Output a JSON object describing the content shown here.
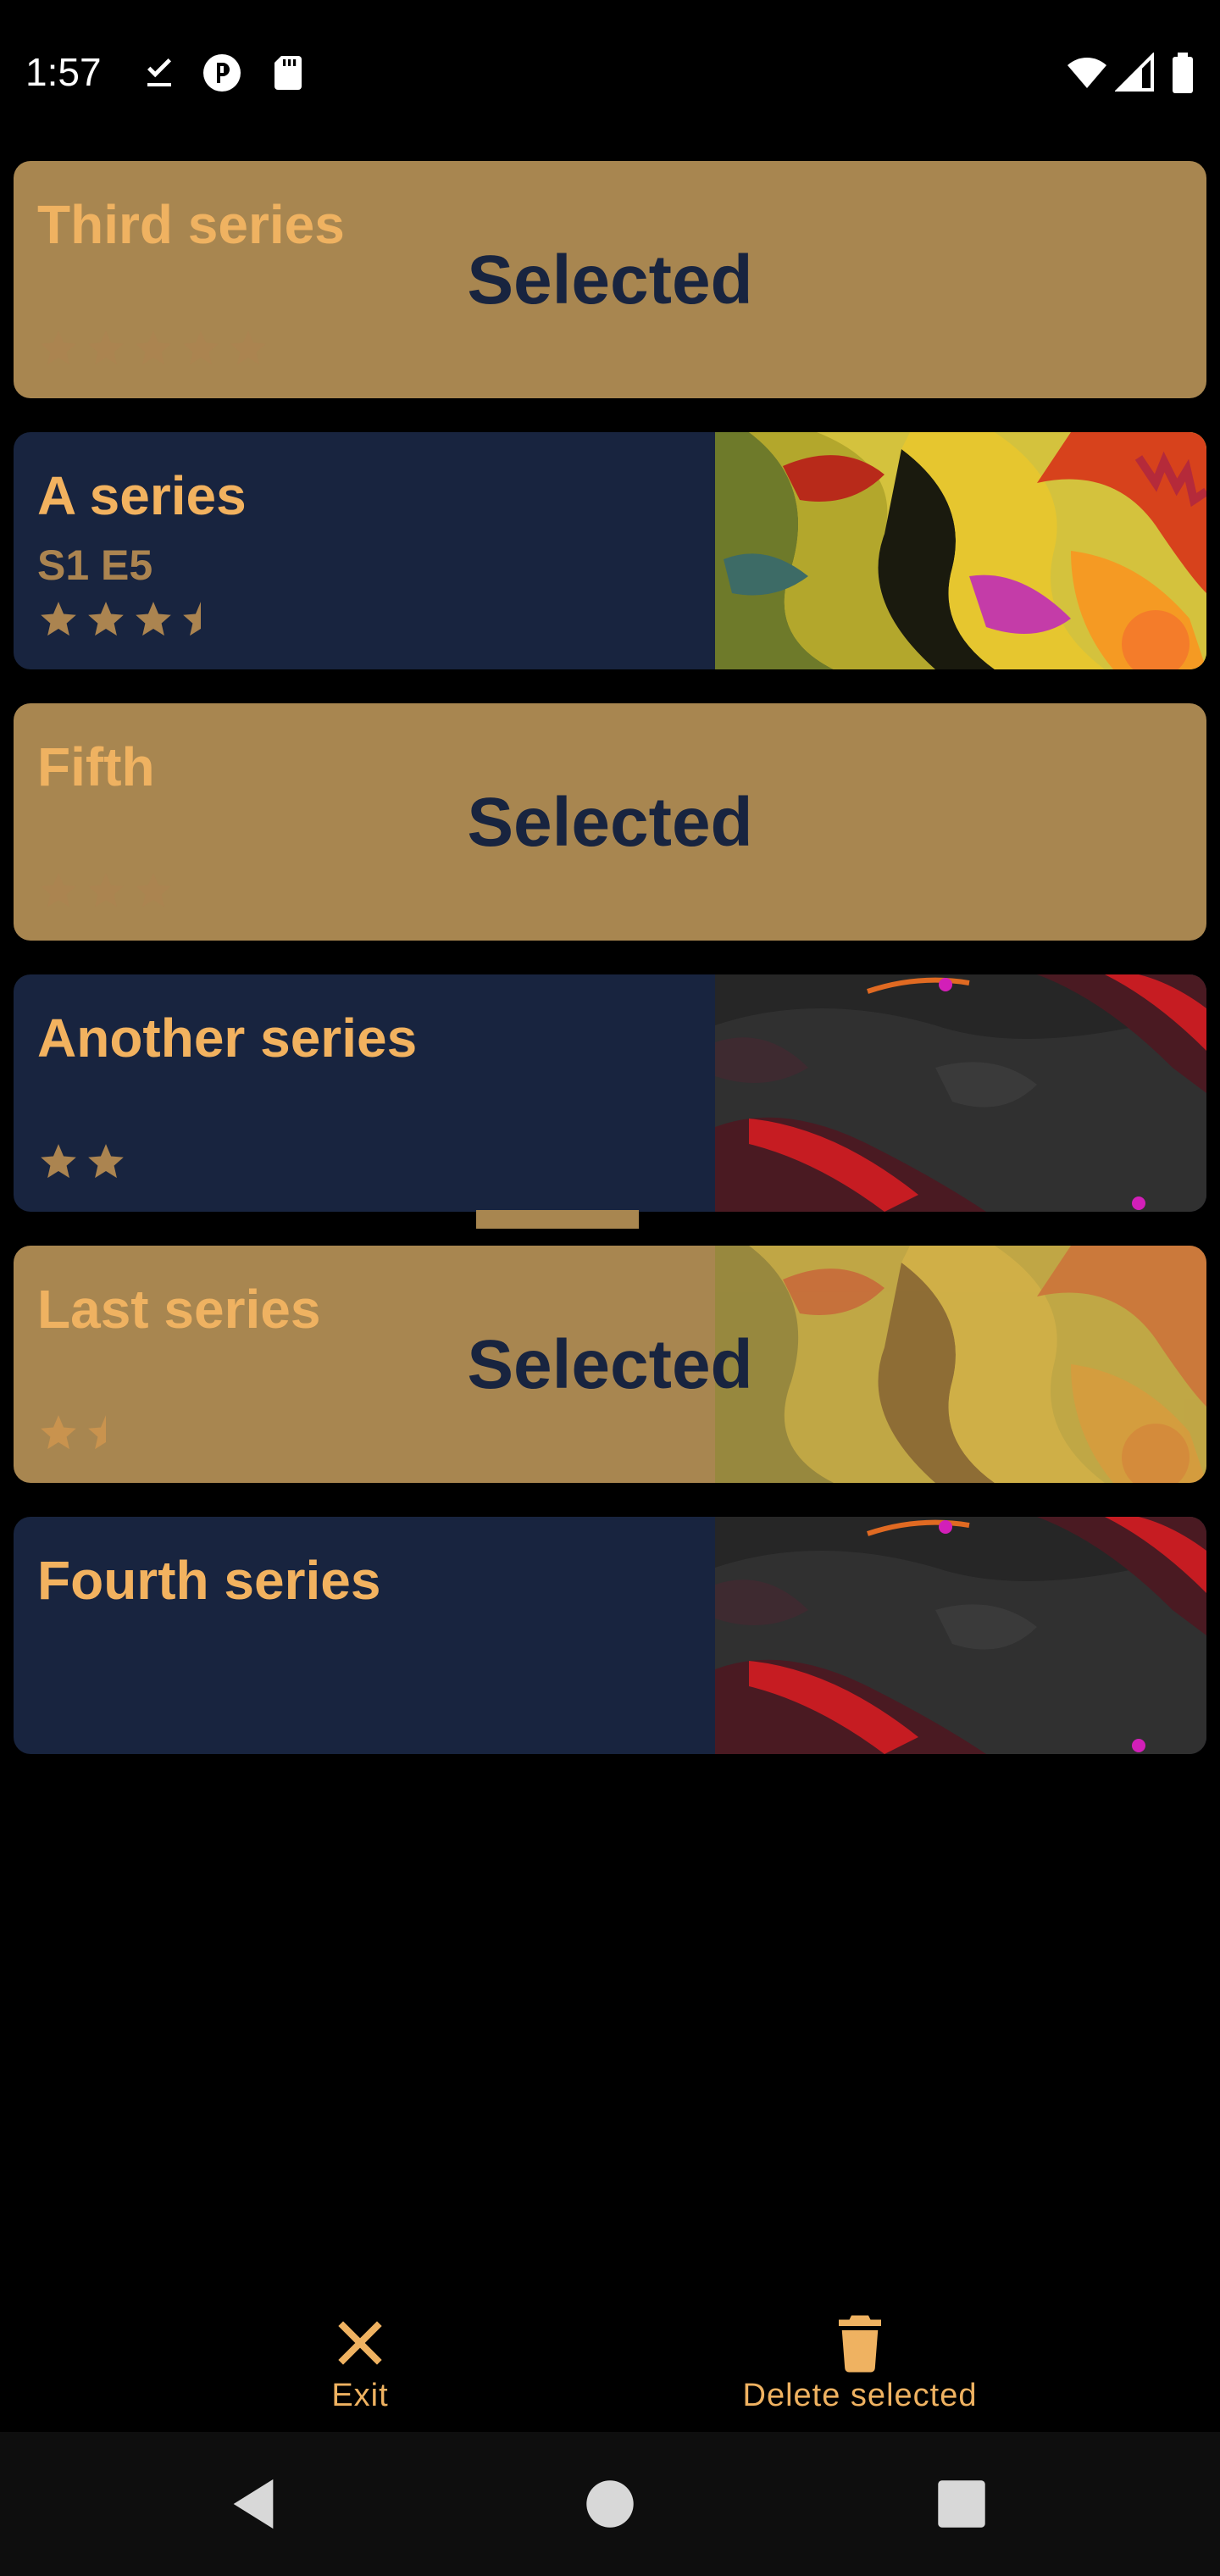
{
  "status_bar": {
    "time": "1:57",
    "left_icons": [
      "download-done-icon",
      "app-notification-icon",
      "sd-card-icon"
    ],
    "right_icons": [
      "wifi-icon",
      "cellular-signal-icon",
      "battery-icon"
    ]
  },
  "series": [
    {
      "title": "Third series",
      "subtitle": "",
      "rating": 5,
      "selected": true,
      "selected_label": "Selected",
      "thumbnail": ""
    },
    {
      "title": "A series",
      "subtitle": "S1 E5",
      "rating": 3.5,
      "selected": false,
      "selected_label": "",
      "thumbnail": "autumn-leaves"
    },
    {
      "title": "Fifth",
      "subtitle": "",
      "rating": 3,
      "selected": true,
      "selected_label": "Selected",
      "thumbnail": ""
    },
    {
      "title": "Another series",
      "subtitle": "",
      "rating": 2,
      "selected": false,
      "selected_label": "",
      "thumbnail": "dark-leaves"
    },
    {
      "title": "Last series",
      "subtitle": "",
      "rating": 1.5,
      "selected": true,
      "selected_label": "Selected",
      "thumbnail": "autumn-leaves"
    },
    {
      "title": "Fourth series",
      "subtitle": "",
      "rating": 0,
      "selected": false,
      "selected_label": "",
      "thumbnail": "dark-leaves"
    }
  ],
  "actions": {
    "exit_label": "Exit",
    "delete_label": "Delete selected"
  },
  "colors": {
    "accent": "#efb261",
    "card_dark": "#18243f",
    "card_selected": "#a88650",
    "star": "#a88650"
  }
}
